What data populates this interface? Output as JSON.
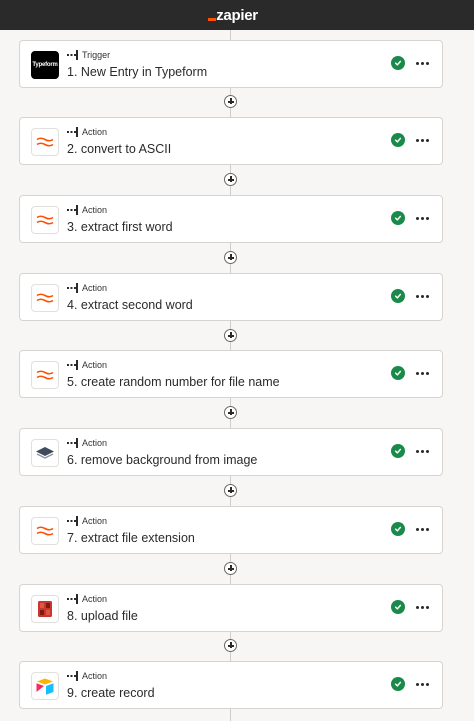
{
  "header": {
    "logo_text": "zapier",
    "accent_color": "#ff4f00",
    "bar_color": "#2b2a2a"
  },
  "steps": [
    {
      "kind": "Trigger",
      "title": "1. New Entry in Typeform",
      "icon": "typeform-icon",
      "icon_text": "Typeform",
      "status": "success"
    },
    {
      "kind": "Action",
      "title": "2. convert to ASCII",
      "icon": "formatter-icon",
      "status": "success"
    },
    {
      "kind": "Action",
      "title": "3. extract first word",
      "icon": "formatter-icon",
      "status": "success"
    },
    {
      "kind": "Action",
      "title": "4. extract second word",
      "icon": "formatter-icon",
      "status": "success"
    },
    {
      "kind": "Action",
      "title": "5. create random number for file name",
      "icon": "formatter-icon",
      "status": "success"
    },
    {
      "kind": "Action",
      "title": "6. remove background from image",
      "icon": "layers-icon",
      "status": "success"
    },
    {
      "kind": "Action",
      "title": "7. extract file extension",
      "icon": "formatter-icon",
      "status": "success"
    },
    {
      "kind": "Action",
      "title": "8. upload file",
      "icon": "amazon-s3-icon",
      "status": "success"
    },
    {
      "kind": "Action",
      "title": "9. create record",
      "icon": "airtable-icon",
      "status": "success"
    }
  ],
  "colors": {
    "success": "#1a8a4a",
    "formatter": "#ff4f00"
  }
}
